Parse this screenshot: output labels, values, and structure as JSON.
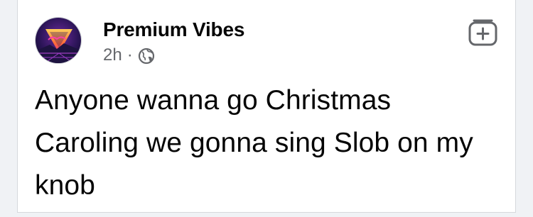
{
  "post": {
    "author": "Premium Vibes",
    "time": "2h",
    "separator": "·",
    "visibility_icon": "globe-icon",
    "action_icon": "add-to-collection-icon",
    "text": "Anyone wanna go Christmas Caroling we gonna sing Slob on my knob"
  },
  "colors": {
    "background": "#f0f2f5",
    "card": "#ffffff",
    "primary_text": "#050505",
    "secondary_text": "#65676b",
    "icon_gray": "#65676b"
  }
}
